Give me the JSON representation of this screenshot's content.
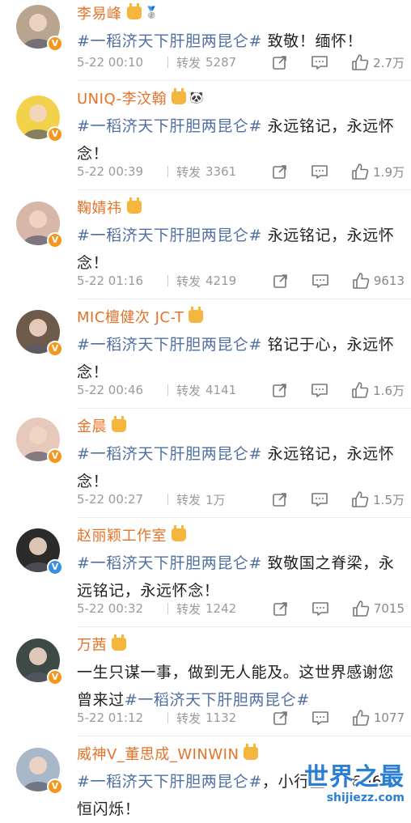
{
  "comments": [
    {
      "name": "李易峰",
      "extra_badge": "🥈",
      "verify": "orange",
      "avatar_color": "#b9a48f",
      "tag": "#一稻济天下肝胆两昆仑#",
      "text": " 致敬！缅怀！",
      "time": "5-22 00:10",
      "repost_label": "转发",
      "repost_count": "5287",
      "like_count": "2.7万"
    },
    {
      "name": "UNIQ-李汶翰",
      "extra_badge": "🐼",
      "verify": "orange",
      "avatar_color": "#f2d24a",
      "tag": "#一稻济天下肝胆两昆仑#",
      "text": " 永远铭记，永远怀念！",
      "time": "5-22 00:39",
      "repost_label": "转发",
      "repost_count": "3361",
      "like_count": "1.9万"
    },
    {
      "name": "鞠婧祎",
      "extra_badge": "",
      "verify": "orange",
      "avatar_color": "#d8b6a8",
      "tag": "#一稻济天下肝胆两昆仑#",
      "text": " 永远铭记，永远怀念！",
      "time": "5-22 01:16",
      "repost_label": "转发",
      "repost_count": "4219",
      "like_count": "9613"
    },
    {
      "name": "MIC檀健次 JC-T",
      "extra_badge": "",
      "verify": "orange",
      "avatar_color": "#6e5a4a",
      "tag": "#一稻济天下肝胆两昆仑#",
      "text": " 铭记于心，永远怀念！",
      "time": "5-22 00:46",
      "repost_label": "转发",
      "repost_count": "4141",
      "like_count": "1.6万"
    },
    {
      "name": "金晨",
      "extra_badge": "",
      "verify": "orange",
      "avatar_color": "#e6c9bb",
      "tag": "#一稻济天下肝胆两昆仑#",
      "text": " 永远铭记，永远怀念！",
      "time": "5-22 00:27",
      "repost_label": "转发",
      "repost_count": "1万",
      "like_count": "1.5万"
    },
    {
      "name": "赵丽颖工作室",
      "extra_badge": "",
      "verify": "blue",
      "avatar_color": "#2b2b2b",
      "tag": "#一稻济天下肝胆两昆仑#",
      "text": " 致敬国之脊梁，永远铭记，永远怀念！",
      "time": "5-22 00:32",
      "repost_label": "转发",
      "repost_count": "1242",
      "like_count": "7015"
    },
    {
      "name": "万茜",
      "extra_badge": "",
      "verify": "orange",
      "avatar_color": "#3d4a45",
      "tag": "#一稻济天下肝胆两昆仑#",
      "text_before": "一生只谋一事，做到无人能及。这世界感谢您曾来过",
      "text": "",
      "time": "5-22 01:12",
      "repost_label": "转发",
      "repost_count": "1132",
      "like_count": "1077"
    },
    {
      "name": "威神V_董思成_WINWIN",
      "extra_badge": "",
      "verify": "orange",
      "avatar_color": "#a9b8c8",
      "tag": "#一稻济天下肝胆两昆仑#",
      "text": "，小行星 17606 永恒闪烁！",
      "time": "",
      "repost_label": "",
      "repost_count": "",
      "like_count": ""
    }
  ],
  "watermark": {
    "title": "世界之最",
    "url": "shijiezz.com"
  }
}
